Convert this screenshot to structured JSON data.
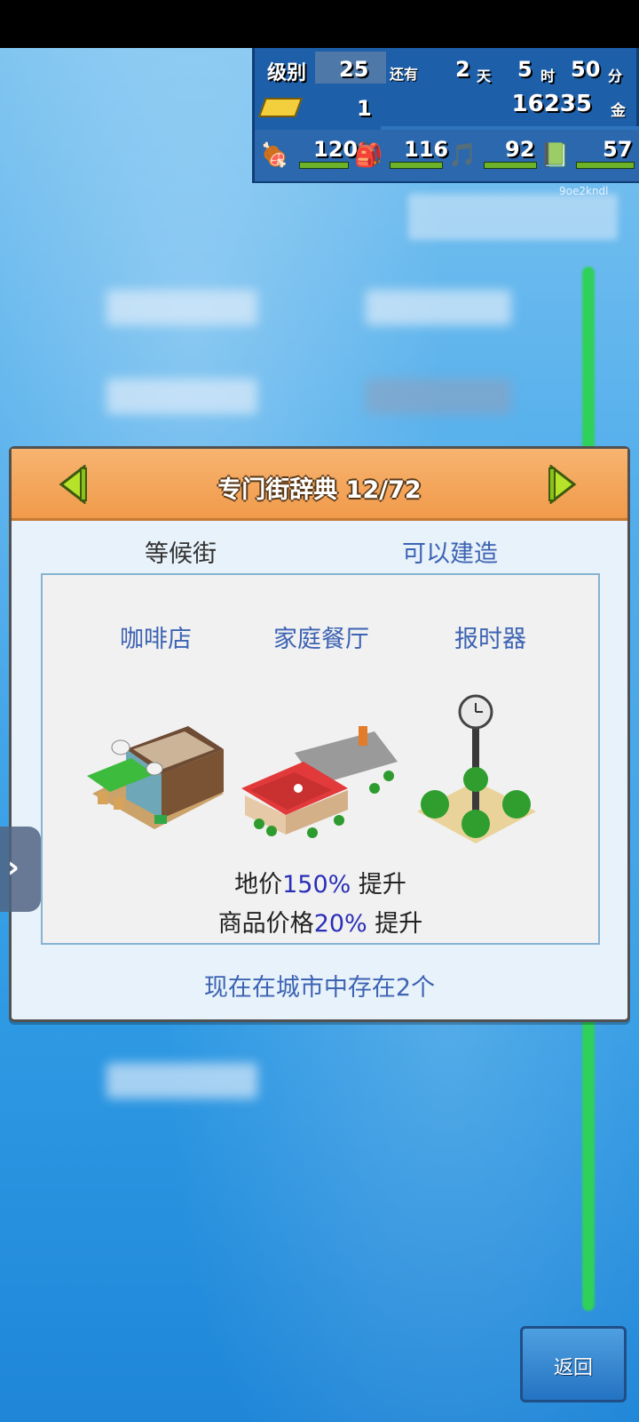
{
  "hud": {
    "level_label": "级别",
    "level_value": "25",
    "remaining_label": "还有",
    "days": "2",
    "days_unit": "天",
    "hours": "5",
    "hours_unit": "时",
    "minutes": "50",
    "minutes_unit": "分",
    "gold_bars": "1",
    "money": "16235",
    "money_unit": "金",
    "stats": [
      {
        "icon": "food-icon",
        "value": "120"
      },
      {
        "icon": "bag-icon",
        "value": "116"
      },
      {
        "icon": "music-icon",
        "value": "92"
      },
      {
        "icon": "book-icon",
        "value": "57"
      }
    ]
  },
  "user_id": "9oe2kndl",
  "dialog": {
    "title": "专门街辞典 12/72",
    "status_left": "等候街",
    "status_right": "可以建造",
    "buildings": [
      {
        "name": "咖啡店",
        "icon": "cafe-building-icon"
      },
      {
        "name": "家庭餐厅",
        "icon": "family-restaurant-icon"
      },
      {
        "name": "报时器",
        "icon": "clock-tower-icon"
      }
    ],
    "effect1": {
      "prefix": "地价",
      "value": "150%",
      "suffix": " 提升"
    },
    "effect2": {
      "prefix": "商品价格",
      "value": "20%",
      "suffix": " 提升"
    },
    "exist_text": "现在在城市中存在2个"
  },
  "back_button": "返回",
  "colors": {
    "header_orange": "#f19a4b",
    "link_blue": "#3d63b3",
    "highlight_blue": "#2a2fb8",
    "background_blue": "#3fa6e6"
  }
}
